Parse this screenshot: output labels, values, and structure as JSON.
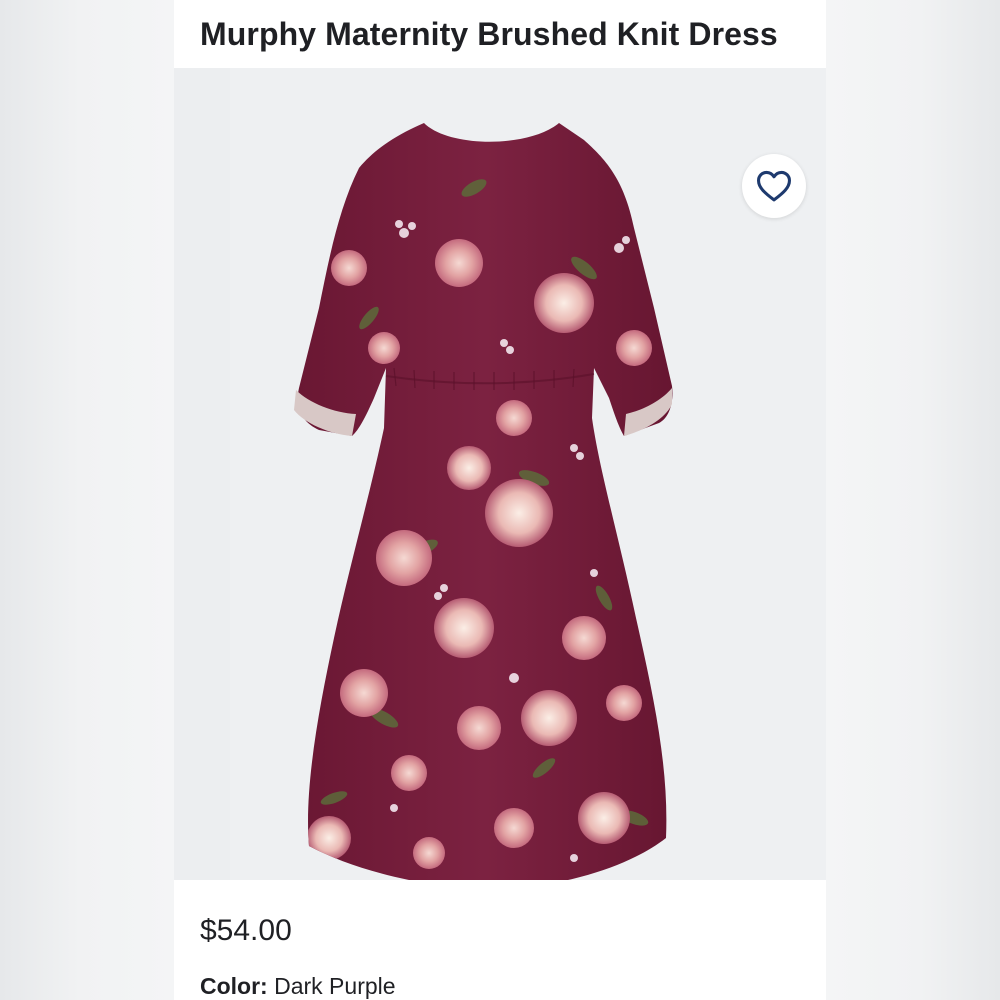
{
  "product": {
    "title": "Murphy Maternity Brushed Knit Dress",
    "price": "$54.00",
    "color_label": "Color:",
    "color_value": "Dark Purple"
  },
  "gallery": {
    "image_subject": "burgundy-floral-dress",
    "active_image_index": 1,
    "image_count": 1
  },
  "icons": {
    "favorite": "heart-outline-icon"
  },
  "colors": {
    "dress_base": "#7a1f3d",
    "favorite_stroke": "#1e3a6e",
    "text": "#1f2024"
  }
}
